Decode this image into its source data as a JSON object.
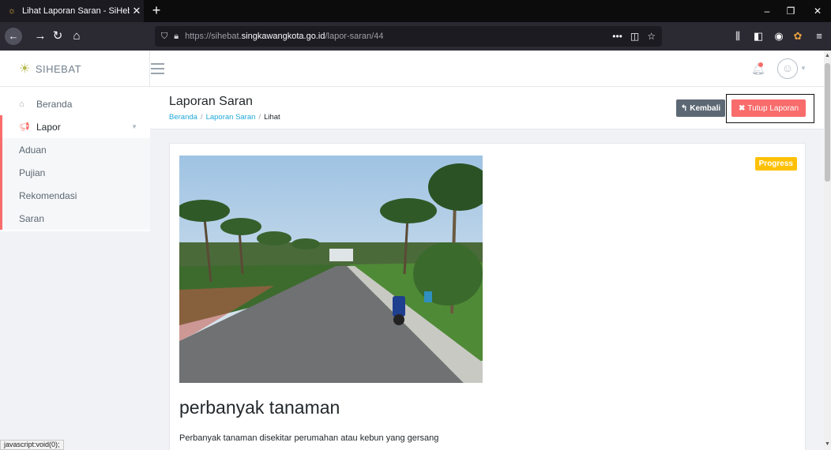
{
  "browser": {
    "tab_title": "Lihat Laporan Saran - SiHebat",
    "url_prefix": "https://sihebat.",
    "url_host": "singkawangkota.go.id",
    "url_path": "/lapor-saran/44",
    "status_text": "javascript:void(0);"
  },
  "app": {
    "brand": "SIHEBAT"
  },
  "sidebar": {
    "items": [
      {
        "label": "Beranda",
        "icon": "home-icon"
      },
      {
        "label": "Lapor",
        "icon": "megaphone-icon"
      }
    ],
    "submenu": [
      "Aduan",
      "Pujian",
      "Rekomendasi",
      "Saran"
    ]
  },
  "page": {
    "title": "Laporan Saran",
    "breadcrumb": [
      "Beranda",
      "Laporan Saran",
      "Lihat"
    ],
    "back_label": "Kembali",
    "close_label": "Tutup Laporan"
  },
  "report": {
    "status": "Progress",
    "title": "perbanyak tanaman",
    "description": "Perbanyak tanaman disekitar perumahan atau kebun yang gersang"
  },
  "colors": {
    "accent_red": "#f86c6b",
    "link_blue": "#20a8d8",
    "badge_yellow": "#ffc107",
    "button_gray": "#5c6873"
  }
}
